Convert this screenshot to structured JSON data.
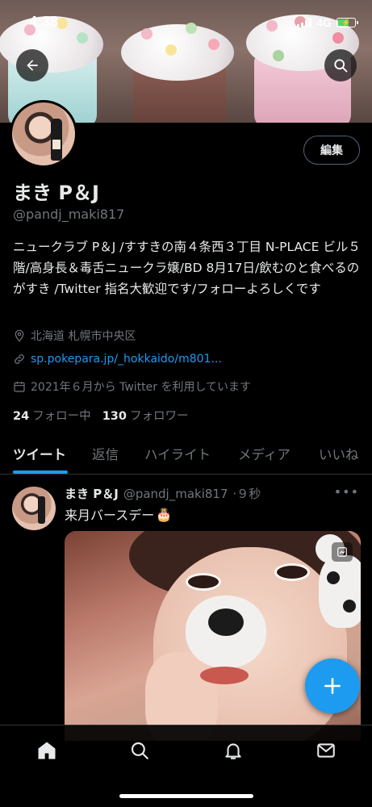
{
  "status_bar": {
    "time": "4:38",
    "network": "4G"
  },
  "profile": {
    "name": "まき P＆J",
    "handle": "@pandj_maki817",
    "bio": "ニュークラブ P＆J /すすきの南４条西３丁目 N-PLACE ビル５階/高身長＆毒舌ニュークラ嬢/BD 8月17日/飲むのと食べるのがすき /Twitter 指名大歓迎です/フォローよろしくです",
    "location": "北海道 札幌市中央区",
    "url": "sp.pokepara.jp/_hokkaido/m801...",
    "joined": "2021年６月から Twitter を利用しています",
    "following_count": "24",
    "following_label": "フォロー中",
    "followers_count": "130",
    "followers_label": "フォロワー",
    "edit_label": "編集"
  },
  "tabs": [
    {
      "label": "ツイート",
      "active": true
    },
    {
      "label": "返信",
      "active": false
    },
    {
      "label": "ハイライト",
      "active": false
    },
    {
      "label": "メディア",
      "active": false
    },
    {
      "label": "いいね",
      "active": false
    }
  ],
  "tweet": {
    "name": "まき P＆J",
    "handle": "@pandj_maki817",
    "time": "·９秒",
    "text": "来月バースデー",
    "emoji": "🎂",
    "more": "•••"
  },
  "colors": {
    "accent": "#1d9bf0",
    "background": "#000000",
    "muted": "#71767b",
    "text": "#e7e9ea"
  },
  "icons": {
    "back": "arrow-left-icon",
    "search": "search-icon",
    "location": "location-pin-icon",
    "link": "link-icon",
    "calendar": "calendar-icon",
    "compose": "plus-icon",
    "nav_home": "home-icon",
    "nav_search": "search-icon",
    "nav_notifications": "bell-icon",
    "nav_messages": "mail-icon"
  }
}
